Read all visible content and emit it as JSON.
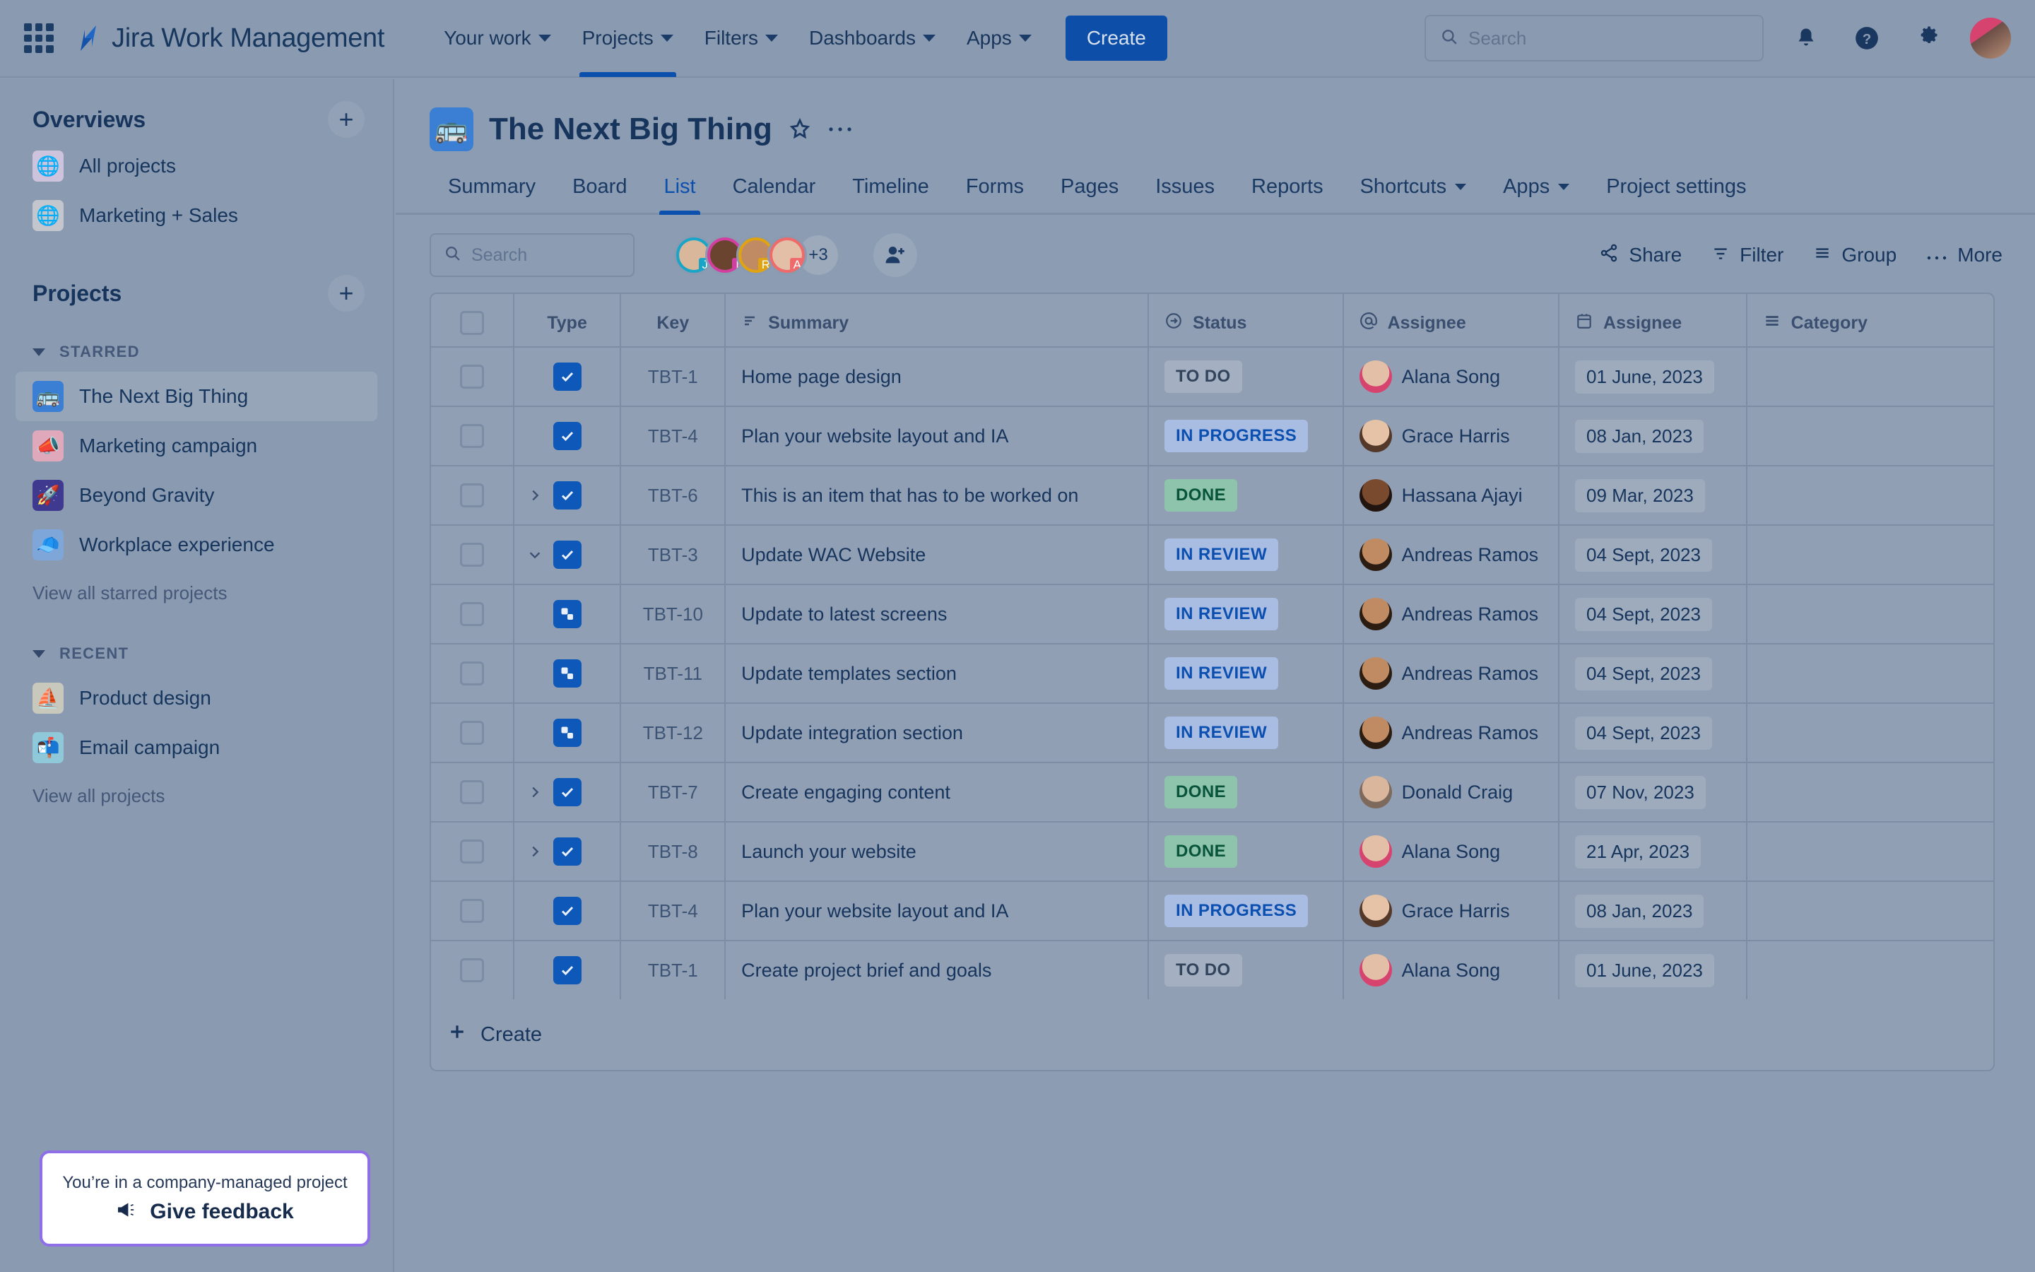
{
  "topnav": {
    "app_switcher_icon": "grid-icon",
    "brand": "Jira Work Management",
    "items": [
      {
        "label": "Your work",
        "has_caret": true,
        "active": false
      },
      {
        "label": "Projects",
        "has_caret": true,
        "active": true
      },
      {
        "label": "Filters",
        "has_caret": true,
        "active": false
      },
      {
        "label": "Dashboards",
        "has_caret": true,
        "active": false
      },
      {
        "label": "Apps",
        "has_caret": true,
        "active": false
      }
    ],
    "create_label": "Create",
    "search_placeholder": "Search",
    "icons": [
      "notifications-bell-icon",
      "help-icon",
      "settings-gear-icon",
      "user-avatar"
    ]
  },
  "sidebar": {
    "overviews_title": "Overviews",
    "overviews": [
      {
        "label": "All projects",
        "emoji": "🌐",
        "bg": "#cdc3dd"
      },
      {
        "label": "Marketing + Sales",
        "emoji": "🌐",
        "bg": "#c3c6cc"
      }
    ],
    "projects_title": "Projects",
    "starred_title": "STARRED",
    "starred": [
      {
        "label": "The Next Big Thing",
        "emoji": "🚌",
        "bg": "#3b7fd4",
        "selected": true
      },
      {
        "label": "Marketing campaign",
        "emoji": "📣",
        "bg": "#e0a8bb",
        "selected": false
      },
      {
        "label": "Beyond Gravity",
        "emoji": "🚀",
        "bg": "#3f3a8f",
        "selected": false
      },
      {
        "label": "Workplace experience",
        "emoji": "🧢",
        "bg": "#7fa6d8",
        "selected": false
      }
    ],
    "view_all_starred": "View all starred projects",
    "recent_title": "RECENT",
    "recent": [
      {
        "label": "Product design",
        "emoji": "⛵",
        "bg": "#c9c8bd",
        "selected": false
      },
      {
        "label": "Email campaign",
        "emoji": "📬",
        "bg": "#8fc8d8",
        "selected": false
      }
    ],
    "view_all_projects": "View all projects"
  },
  "feedback": {
    "text": "You’re in a company-managed project",
    "cta": "Give feedback",
    "icon": "megaphone-icon",
    "border_color": "#8f6fe8"
  },
  "project": {
    "emoji": "🚌",
    "title": "The Next Big Thing",
    "star_icon": "star-icon",
    "more_icon": "more-actions-icon",
    "tabs": [
      {
        "label": "Summary",
        "active": false,
        "caret": false
      },
      {
        "label": "Board",
        "active": false,
        "caret": false
      },
      {
        "label": "List",
        "active": true,
        "caret": false
      },
      {
        "label": "Calendar",
        "active": false,
        "caret": false
      },
      {
        "label": "Timeline",
        "active": false,
        "caret": false
      },
      {
        "label": "Forms",
        "active": false,
        "caret": false
      },
      {
        "label": "Pages",
        "active": false,
        "caret": false
      },
      {
        "label": "Issues",
        "active": false,
        "caret": false
      },
      {
        "label": "Reports",
        "active": false,
        "caret": false
      },
      {
        "label": "Shortcuts",
        "active": false,
        "caret": true
      },
      {
        "label": "Apps",
        "active": false,
        "caret": true
      },
      {
        "label": "Project settings",
        "active": false,
        "caret": false
      }
    ]
  },
  "toolbar": {
    "search_placeholder": "Search",
    "avatars": [
      {
        "initial": "J",
        "ring": "#1aa5c8",
        "chip": "#1aa5c8",
        "face": "#d8b79a"
      },
      {
        "initial": "I",
        "ring": "#d23fa0",
        "chip": "#d23fa0",
        "face": "#6b4430"
      },
      {
        "initial": "R",
        "ring": "#e0a311",
        "chip": "#e0a311",
        "face": "#c08b63"
      },
      {
        "initial": "A",
        "ring": "#ef6a6a",
        "chip": "#ef6a6a",
        "face": "#e3bfa8"
      }
    ],
    "avatar_overflow": "+3",
    "add_people_icon": "add-person-icon",
    "actions": [
      {
        "label": "Share",
        "icon": "share-icon"
      },
      {
        "label": "Filter",
        "icon": "filter-icon"
      },
      {
        "label": "Group",
        "icon": "group-icon"
      },
      {
        "label": "More",
        "icon": "more-icon"
      }
    ]
  },
  "table": {
    "columns": [
      {
        "label": "",
        "icon": "select-all-checkbox",
        "key": "check"
      },
      {
        "label": "Type",
        "icon": "",
        "key": "type"
      },
      {
        "label": "Key",
        "icon": "",
        "key": "key"
      },
      {
        "label": "Summary",
        "icon": "summary-icon",
        "key": "summary"
      },
      {
        "label": "Status",
        "icon": "status-arrow-icon",
        "key": "status"
      },
      {
        "label": "Assignee",
        "icon": "mention-icon",
        "key": "assignee"
      },
      {
        "label": "Assignee",
        "icon": "calendar-icon",
        "key": "date"
      },
      {
        "label": "Category",
        "icon": "list-icon",
        "key": "category"
      }
    ],
    "rows": [
      {
        "type": "task",
        "expander": "none",
        "key": "TBT-1",
        "summary": "Home page design",
        "status": "TO DO",
        "status_kind": "todo",
        "assignee": "Alana Song",
        "face": "#e3bfa8",
        "hair": "#d6436f",
        "date": "01 June, 2023",
        "category": ""
      },
      {
        "type": "task",
        "expander": "none",
        "key": "TBT-4",
        "summary": "Plan your website layout and IA",
        "status": "IN PROGRESS",
        "status_kind": "prog",
        "assignee": "Grace Harris",
        "face": "#e6c3a6",
        "hair": "#54392a",
        "date": "08 Jan, 2023",
        "category": ""
      },
      {
        "type": "task",
        "expander": "collapsed",
        "key": "TBT-6",
        "summary": "This is an item that has to be worked on",
        "status": "DONE",
        "status_kind": "done",
        "assignee": "Hassana Ajayi",
        "face": "#7a4a2e",
        "hair": "#221510",
        "date": "09 Mar, 2023",
        "category": ""
      },
      {
        "type": "task",
        "expander": "expanded",
        "key": "TBT-3",
        "summary": "Update WAC Website",
        "status": "IN REVIEW",
        "status_kind": "rev",
        "assignee": "Andreas Ramos",
        "face": "#c08b63",
        "hair": "#2b1d12",
        "date": "04 Sept, 2023",
        "category": ""
      },
      {
        "type": "subtask",
        "expander": "none",
        "key": "TBT-10",
        "summary": "Update to latest screens",
        "status": "IN REVIEW",
        "status_kind": "rev",
        "assignee": "Andreas Ramos",
        "face": "#c08b63",
        "hair": "#2b1d12",
        "date": "04 Sept, 2023",
        "category": ""
      },
      {
        "type": "subtask",
        "expander": "none",
        "key": "TBT-11",
        "summary": "Update templates section",
        "status": "IN REVIEW",
        "status_kind": "rev",
        "assignee": "Andreas Ramos",
        "face": "#c08b63",
        "hair": "#2b1d12",
        "date": "04 Sept, 2023",
        "category": ""
      },
      {
        "type": "subtask",
        "expander": "none",
        "key": "TBT-12",
        "summary": "Update integration section",
        "status": "IN REVIEW",
        "status_kind": "rev",
        "assignee": "Andreas Ramos",
        "face": "#c08b63",
        "hair": "#2b1d12",
        "date": "04 Sept, 2023",
        "category": ""
      },
      {
        "type": "task",
        "expander": "collapsed",
        "key": "TBT-7",
        "summary": "Create engaging content",
        "status": "DONE",
        "status_kind": "done",
        "assignee": "Donald Craig",
        "face": "#d9b69c",
        "hair": "#7d6a5c",
        "date": "07 Nov, 2023",
        "category": ""
      },
      {
        "type": "task",
        "expander": "collapsed",
        "key": "TBT-8",
        "summary": "Launch your website",
        "status": "DONE",
        "status_kind": "done",
        "assignee": "Alana Song",
        "face": "#e3bfa8",
        "hair": "#d6436f",
        "date": "21 Apr, 2023",
        "category": ""
      },
      {
        "type": "task",
        "expander": "none",
        "key": "TBT-4",
        "summary": "Plan your website layout and IA",
        "status": "IN PROGRESS",
        "status_kind": "prog",
        "assignee": "Grace Harris",
        "face": "#e6c3a6",
        "hair": "#54392a",
        "date": "08 Jan, 2023",
        "category": ""
      },
      {
        "type": "task",
        "expander": "none",
        "key": "TBT-1",
        "summary": "Create project brief and goals",
        "status": "TO DO",
        "status_kind": "todo",
        "assignee": "Alana Song",
        "face": "#e3bfa8",
        "hair": "#d6436f",
        "date": "01 June, 2023",
        "category": ""
      }
    ],
    "create_label": "Create"
  }
}
